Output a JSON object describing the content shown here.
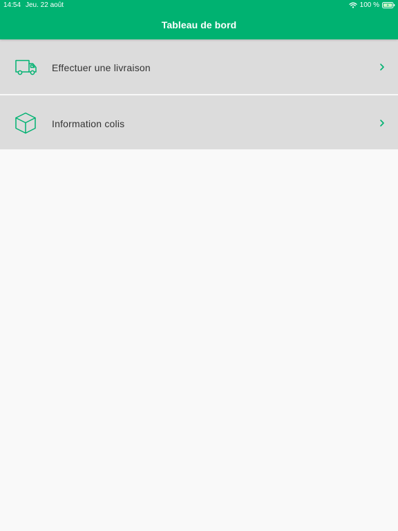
{
  "status_bar": {
    "time": "14:54",
    "date": "Jeu. 22 août",
    "battery": "100 %",
    "icons": [
      "wifi-icon",
      "battery-charging-icon"
    ]
  },
  "header": {
    "title": "Tableau de bord"
  },
  "menu": {
    "items": [
      {
        "label": "Effectuer une livraison",
        "icon": "truck-icon"
      },
      {
        "label": "Information colis",
        "icon": "package-icon"
      }
    ]
  },
  "colors": {
    "accent": "#00b271",
    "item_background": "#dcdcdc",
    "page_background": "#f9f9f9",
    "text": "#333333"
  }
}
